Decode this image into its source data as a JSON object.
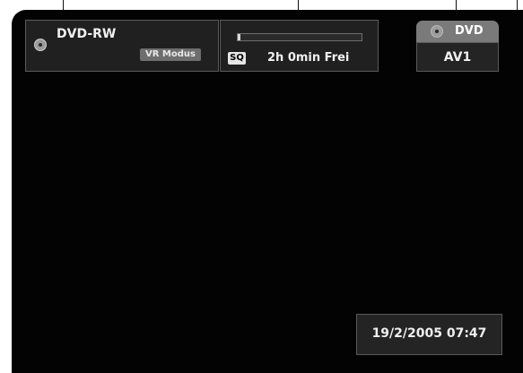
{
  "disc_status": {
    "disc_type": "DVD-RW",
    "mode_badge": "VR Modus"
  },
  "recording": {
    "quality": "SQ",
    "remaining": "2h 0min Frei",
    "usage_fraction": 0.02
  },
  "source": {
    "tab_label": "DVD",
    "input": "AV1"
  },
  "clock": {
    "datetime": "19/2/2005 07:47"
  }
}
